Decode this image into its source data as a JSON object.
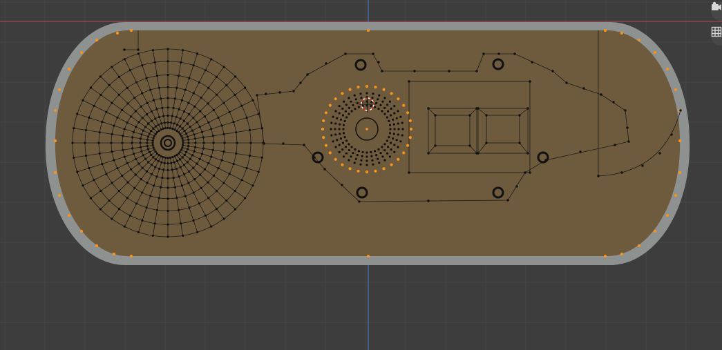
{
  "viewport": {
    "background": "#3d3d3d",
    "grid_color": "#474747",
    "x_axis_color": "#b2485c",
    "y_axis_color": "#4a7fc8",
    "mesh_face_color": "#6e5a3c",
    "mesh_rim_color": "#8d918f",
    "selected_vertex_color": "#f5941f",
    "vertex_color": "#111111",
    "edge_color": "#1b1b1b"
  },
  "navigation": {
    "camera_icon": "camera-icon",
    "grid_icon": "grid-toggle-icon"
  }
}
